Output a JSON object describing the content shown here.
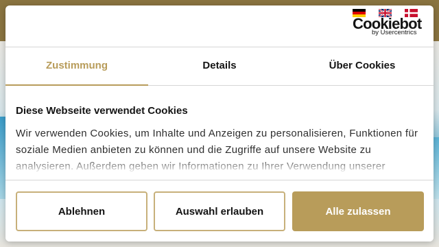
{
  "brand": {
    "logo_text": "Cookiebot",
    "logo_subtext": "by Usercentrics",
    "languages": [
      {
        "code": "de",
        "icon": "german-flag-icon"
      },
      {
        "code": "en",
        "icon": "uk-flag-icon"
      },
      {
        "code": "da",
        "icon": "danish-flag-icon"
      }
    ]
  },
  "tabs": [
    {
      "label": "Zustimmung",
      "active": true
    },
    {
      "label": "Details",
      "active": false
    },
    {
      "label": "Über Cookies",
      "active": false
    }
  ],
  "content": {
    "title": "Diese Webseite verwendet Cookies",
    "body": "Wir verwenden Cookies, um Inhalte und Anzeigen zu personalisieren, Funktionen für soziale Medien anbieten zu können und die Zugriffe auf unsere Website zu analysieren. Außerdem geben wir Informationen zu Ihrer Verwendung unserer"
  },
  "buttons": {
    "decline": "Ablehnen",
    "allow_selection": "Auswahl erlauben",
    "allow_all": "Alle zulassen"
  },
  "colors": {
    "accent": "#b89c5a",
    "button_border": "#c7b07a",
    "text": "#141414"
  }
}
